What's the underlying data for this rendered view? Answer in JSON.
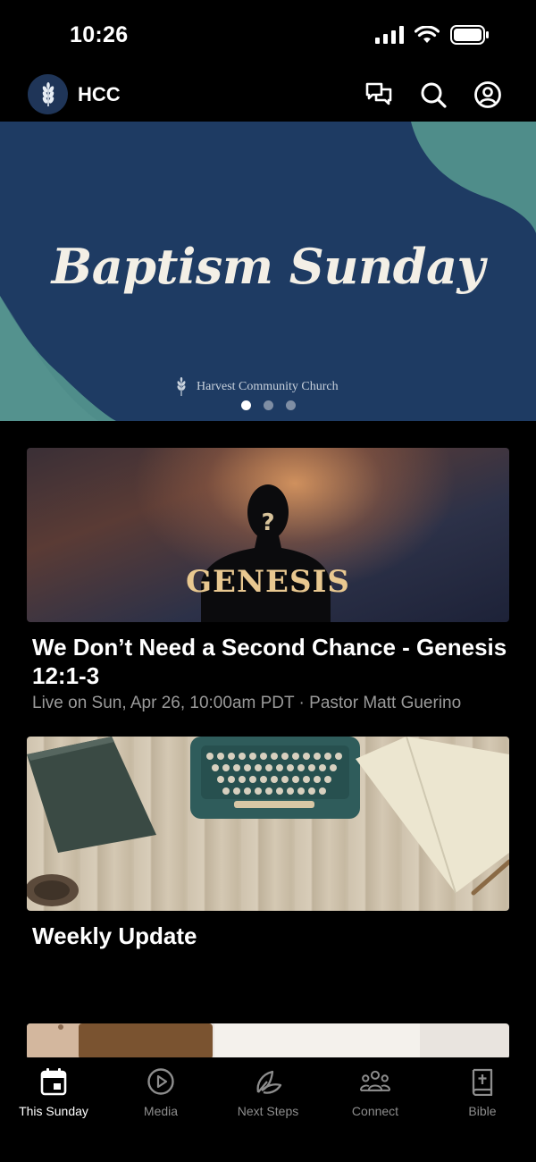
{
  "status_bar": {
    "time": "10:26"
  },
  "header": {
    "title": "HCC"
  },
  "hero": {
    "title": "Baptism Sunday",
    "subtitle": "Harvest Community Church",
    "active_slide": 1,
    "slide_count": 3
  },
  "feed": [
    {
      "image_text": "GENESIS",
      "title": "We Don’t Need a Second Chance - Genesis 12:1-3",
      "meta": "Live on Sun, Apr 26, 10:00am PDT · Pastor Matt Guerino"
    },
    {
      "title": "Weekly Update"
    }
  ],
  "nav": [
    {
      "label": "This Sunday",
      "icon": "calendar-icon",
      "active": true
    },
    {
      "label": "Media",
      "icon": "play-icon",
      "active": false
    },
    {
      "label": "Next Steps",
      "icon": "leaf-icon",
      "active": false
    },
    {
      "label": "Connect",
      "icon": "people-icon",
      "active": false
    },
    {
      "label": "Bible",
      "icon": "bible-icon",
      "active": false
    }
  ],
  "colors": {
    "background": "#000000",
    "hero_navy": "#1e3b63",
    "hero_teal": "#4f8d8a",
    "genesis_gold": "#e9c890",
    "nav_active": "#ffffff",
    "nav_inactive": "#8d8d8d"
  }
}
